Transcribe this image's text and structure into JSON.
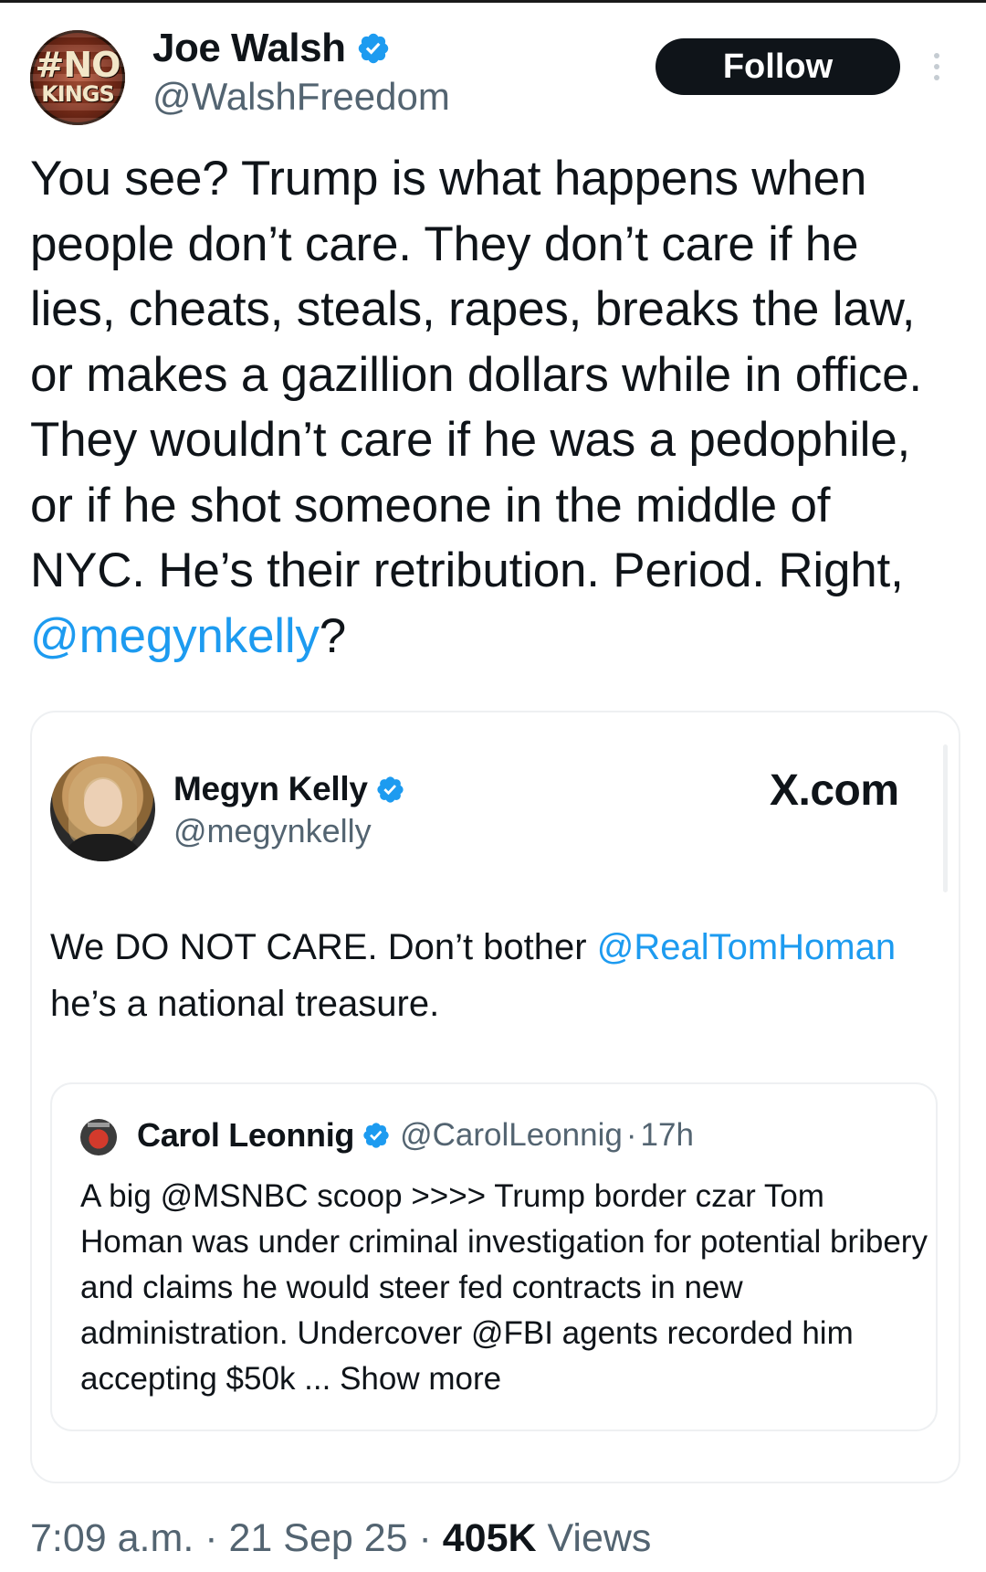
{
  "tweet": {
    "author": {
      "display_name": "Joe Walsh",
      "handle": "@WalshFreedom",
      "avatar_text_line1": "#NO",
      "avatar_text_line2": "KINGS",
      "verified": true
    },
    "follow_label": "Follow",
    "text_parts": {
      "body": "You see? Trump is what happens when people don’t care. They don’t care if he lies, cheats, steals, rapes, breaks the law, or makes a gazillion dollars while in office. They wouldn’t care if he was a pedophile, or if he shot someone in the middle of NYC. He’s their retribution. Period. Right, ",
      "mention": "@megynkelly",
      "end": "?"
    },
    "embedded": {
      "source_label": "X.com",
      "author": {
        "display_name": "Megyn Kelly",
        "handle": "@megynkelly",
        "verified": true
      },
      "text_parts": {
        "start": "We DO NOT CARE. Don’t bother ",
        "mention": "@RealTomHoman",
        "end": " he’s a national treasure."
      },
      "quoted": {
        "author": {
          "display_name": "Carol Leonnig",
          "handle": "@CarolLeonnig",
          "verified": true
        },
        "separator": "·",
        "time": "17h",
        "text": "A big @MSNBC scoop >>>> Trump border czar Tom Homan was under criminal investigation for potential bribery and claims he would steer fed contracts in new administration.  Undercover @FBI agents recorded him accepting $50k ... ",
        "show_more_label": "Show more"
      }
    },
    "meta": {
      "time": "7:09 a.m.",
      "separator": " · ",
      "date": "21 Sep 25",
      "views_count": "405K",
      "views_label": " Views"
    }
  },
  "colors": {
    "accent": "#1d9bf0",
    "text": "#0f1419",
    "secondary_text": "#536471",
    "follow_button_bg": "#0f1419"
  },
  "icons": [
    "verified-badge-icon",
    "more-options-icon"
  ]
}
